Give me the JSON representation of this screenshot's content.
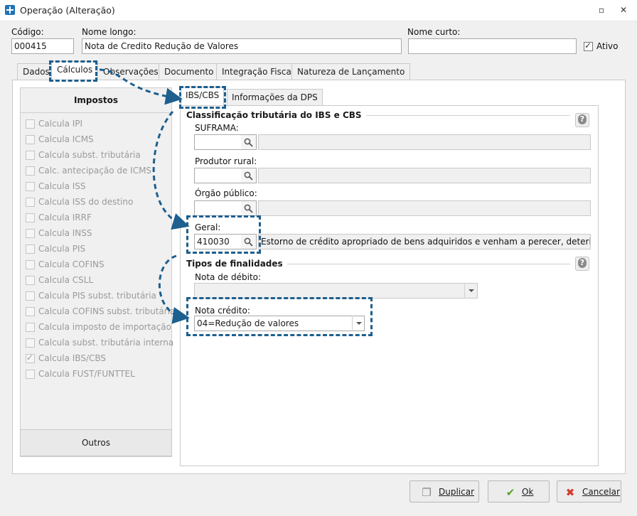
{
  "window": {
    "title": "Operação (Alteração)"
  },
  "header": {
    "codigo_label": "Código:",
    "codigo_value": "000415",
    "nome_longo_label": "Nome longo:",
    "nome_longo_value": "Nota de Credito Redução de Valores",
    "nome_curto_label": "Nome curto:",
    "nome_curto_value": "",
    "ativo_label": "Ativo",
    "ativo_checked": true
  },
  "tabs": [
    "Dados",
    "Cálculos",
    "Observações",
    "Documento",
    "Integração Fiscal",
    "Natureza de Lançamento"
  ],
  "active_tab": "Cálculos",
  "impostos": {
    "title": "Impostos",
    "items": [
      {
        "label": "Calcula IPI",
        "checked": false
      },
      {
        "label": "Calcula ICMS",
        "checked": false
      },
      {
        "label": "Calcula subst. tributária",
        "checked": false
      },
      {
        "label": "Calc. antecipação de ICMS",
        "checked": false
      },
      {
        "label": "Calcula ISS",
        "checked": false
      },
      {
        "label": "Calcula ISS do destino",
        "checked": false
      },
      {
        "label": "Calcula IRRF",
        "checked": false
      },
      {
        "label": "Calcula INSS",
        "checked": false
      },
      {
        "label": "Calcula PIS",
        "checked": false
      },
      {
        "label": "Calcula COFINS",
        "checked": false
      },
      {
        "label": "Calcula CSLL",
        "checked": false
      },
      {
        "label": "Calcula PIS subst. tributária",
        "checked": false
      },
      {
        "label": "Calcula COFINS subst. tributária",
        "checked": false
      },
      {
        "label": "Calcula imposto de importação",
        "checked": false
      },
      {
        "label": "Calcula subst. tributária interna",
        "checked": false
      },
      {
        "label": "Calcula IBS/CBS",
        "checked": true
      },
      {
        "label": "Calcula FUST/FUNTTEL",
        "checked": false
      }
    ],
    "outros_label": "Outros"
  },
  "inner_tabs": [
    "IBS/CBS",
    "Informações da DPS"
  ],
  "classificacao": {
    "title": "Classificação tributária do IBS e CBS",
    "suframa_label": "SUFRAMA:",
    "suframa_code": "",
    "suframa_desc": "",
    "produtor_label": "Produtor rural:",
    "produtor_code": "",
    "produtor_desc": "",
    "orgao_label": "Órgão público:",
    "orgao_code": "",
    "orgao_desc": "",
    "geral_label": "Geral:",
    "geral_code": "410030",
    "geral_desc": "Estorno de crédito apropriado de bens adquiridos e venham a perecer, deteriorar-se ou s"
  },
  "finalidades": {
    "title": "Tipos de finalidades",
    "nota_debito_label": "Nota de débito:",
    "nota_debito_value": "",
    "nota_credito_label": "Nota crédito:",
    "nota_credito_value": "04=Redução de valores"
  },
  "buttons": {
    "duplicar": "Duplicar",
    "ok": "Ok",
    "cancelar": "Cancelar"
  },
  "colors": {
    "annotation": "#1d5f8e",
    "ok_icon": "#5aa02c",
    "cancel_icon": "#d23b2b"
  }
}
